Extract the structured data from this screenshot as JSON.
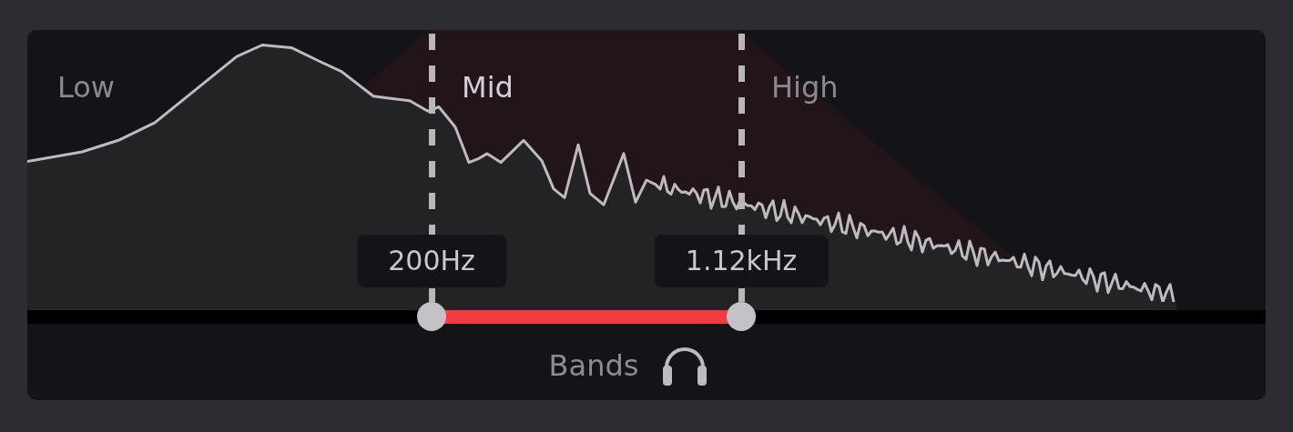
{
  "bands": [
    {
      "label": "Low",
      "selected": false
    },
    {
      "label": "Mid",
      "selected": true
    },
    {
      "label": "High",
      "selected": false
    }
  ],
  "crossovers": [
    {
      "label": "200Hz",
      "level": 0.3265
    },
    {
      "label": "1.12kHz",
      "level": 0.5765
    }
  ],
  "footer": {
    "label": "Bands"
  }
}
